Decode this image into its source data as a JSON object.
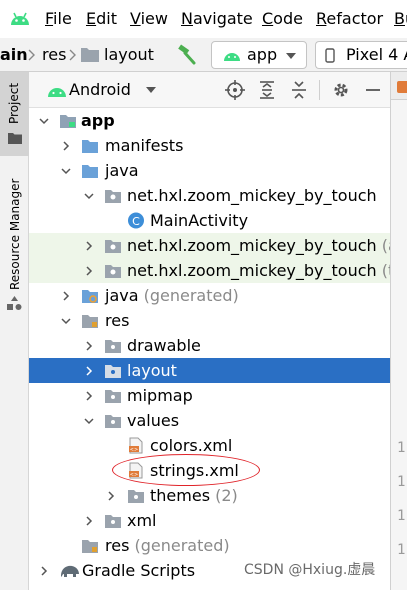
{
  "menubar": {
    "items": [
      {
        "label": "File",
        "mnemonic": "F",
        "rest": "ile"
      },
      {
        "label": "Edit",
        "mnemonic": "E",
        "rest": "dit"
      },
      {
        "label": "View",
        "mnemonic": "V",
        "rest": "iew"
      },
      {
        "label": "Navigate",
        "mnemonic": "N",
        "rest": "avigate"
      },
      {
        "label": "Code",
        "mnemonic": "C",
        "rest": "ode"
      },
      {
        "label": "Refactor",
        "mnemonic": "R",
        "rest": "efactor"
      },
      {
        "label": "Bu",
        "mnemonic": "B",
        "rest": "u"
      }
    ]
  },
  "navbar": {
    "crumbs": [
      "ain",
      "res",
      "layout"
    ],
    "run_config": "app",
    "device": "Pixel 4 A"
  },
  "stripe": {
    "project_label": "Project",
    "resource_manager_label": "Resource Manager"
  },
  "panel": {
    "view_mode": "Android"
  },
  "tree": {
    "rows": [
      {
        "label": "app",
        "extra": ""
      },
      {
        "label": "manifests",
        "extra": ""
      },
      {
        "label": "java",
        "extra": ""
      },
      {
        "label": "net.hxl.zoom_mickey_by_touch",
        "extra": ""
      },
      {
        "label": "MainActivity",
        "extra": ""
      },
      {
        "label": "net.hxl.zoom_mickey_by_touch",
        "extra": " (and"
      },
      {
        "label": "net.hxl.zoom_mickey_by_touch",
        "extra": " (test"
      },
      {
        "label": "java",
        "extra": " (generated)"
      },
      {
        "label": "res",
        "extra": ""
      },
      {
        "label": "drawable",
        "extra": ""
      },
      {
        "label": "layout",
        "extra": ""
      },
      {
        "label": "mipmap",
        "extra": ""
      },
      {
        "label": "values",
        "extra": ""
      },
      {
        "label": "colors.xml",
        "extra": ""
      },
      {
        "label": "strings.xml",
        "extra": ""
      },
      {
        "label": "themes",
        "extra": " (2)"
      },
      {
        "label": "xml",
        "extra": ""
      },
      {
        "label": "res",
        "extra": " (generated)"
      },
      {
        "label": "Gradle Scripts",
        "extra": ""
      }
    ]
  },
  "editor": {
    "gutter": [
      "1",
      "1",
      "1",
      "1"
    ]
  },
  "watermark": "CSDN @Hxiug.虚晨",
  "colors": {
    "selection": "#2a6fc4",
    "android_green": "#3ddc84",
    "folder_blue": "#6aa1d8",
    "highlight_oval": "#e0242a"
  }
}
